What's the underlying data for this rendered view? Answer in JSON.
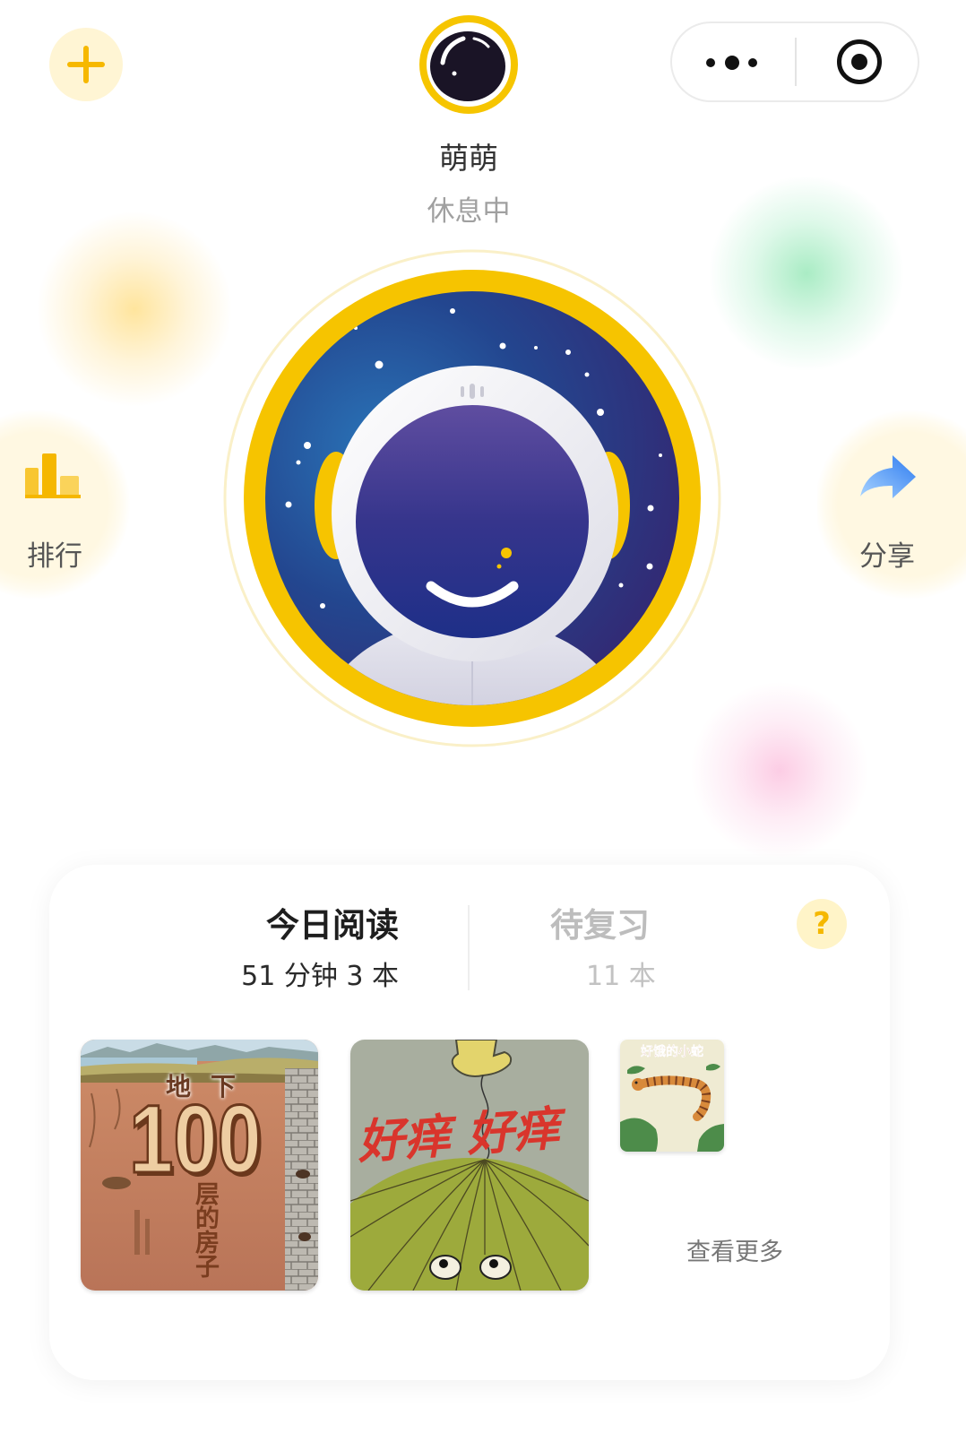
{
  "colors": {
    "accent": "#F6C500",
    "accent_soft": "#FFF4CC",
    "text_primary": "#222222",
    "text_secondary": "#A0A0A0",
    "share_blue": "#3D8BF2",
    "space_blue": "#22468F",
    "space_purple": "#35236E"
  },
  "header": {
    "add_icon": "plus-icon",
    "avatar_icon": "astronaut-avatar-icon",
    "capsule": {
      "more_icon": "more-dots-icon",
      "close_icon": "target-circle-icon"
    }
  },
  "profile": {
    "name": "萌萌",
    "status": "休息中",
    "hero_icon": "astronaut-icon"
  },
  "side_actions": {
    "ranking": {
      "label": "排行",
      "icon": "bar-chart-icon"
    },
    "share": {
      "label": "分享",
      "icon": "share-arrow-icon"
    }
  },
  "reading_card": {
    "tabs": [
      {
        "title": "今日阅读",
        "subtitle": "51 分钟 3 本",
        "active": true
      },
      {
        "title": "待复习",
        "subtitle": "11 本",
        "active": false
      }
    ],
    "help_icon": "question-mark-icon",
    "help_label": "?",
    "books": [
      {
        "cover_top": "地下",
        "cover_number": "100",
        "cover_bottom": "层的房子"
      },
      {
        "cover_title": "好痒 好痒"
      },
      {
        "cover_title": "好饿的小蛇"
      }
    ],
    "more_label": "查看更多"
  }
}
